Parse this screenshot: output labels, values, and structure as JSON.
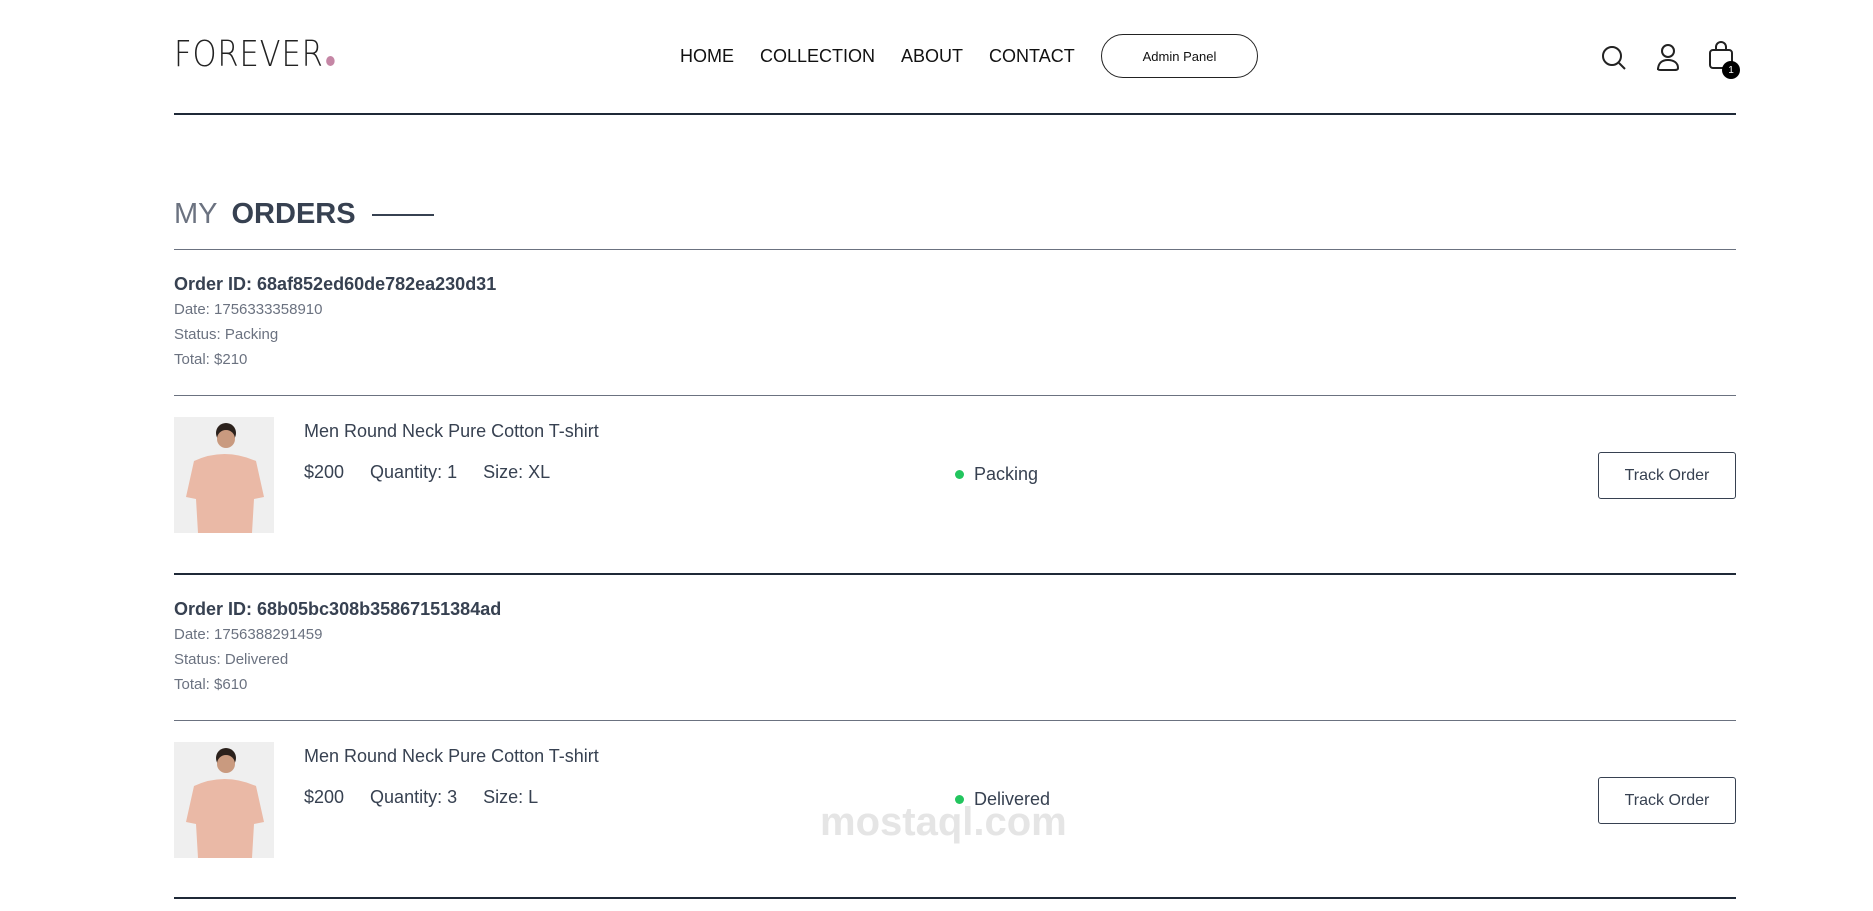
{
  "header": {
    "logo": "FOREVER",
    "nav": [
      "HOME",
      "COLLECTION",
      "ABOUT",
      "CONTACT"
    ],
    "admin_button": "Admin Panel",
    "cart_count": "1"
  },
  "title": {
    "part1": "MY",
    "part2": "ORDERS"
  },
  "orders": [
    {
      "id": "Order ID: 68af852ed60de782ea230d31",
      "date": "Date: 1756333358910",
      "status": "Status: Packing",
      "total": "Total: $210",
      "item": {
        "name": "Men Round Neck Pure Cotton T-shirt",
        "price": "$200",
        "quantity": "Quantity: 1",
        "size": "Size: XL",
        "status": "Packing",
        "track": "Track Order"
      }
    },
    {
      "id": "Order ID: 68b05bc308b35867151384ad",
      "date": "Date: 1756388291459",
      "status": "Status: Delivered",
      "total": "Total: $610",
      "item": {
        "name": "Men Round Neck Pure Cotton T-shirt",
        "price": "$200",
        "quantity": "Quantity: 3",
        "size": "Size: L",
        "status": "Delivered",
        "track": "Track Order"
      }
    }
  ],
  "colors": {
    "status_dot": "#22c55e",
    "logo_dot": "#c586a5"
  },
  "watermark": "mostaql.com"
}
